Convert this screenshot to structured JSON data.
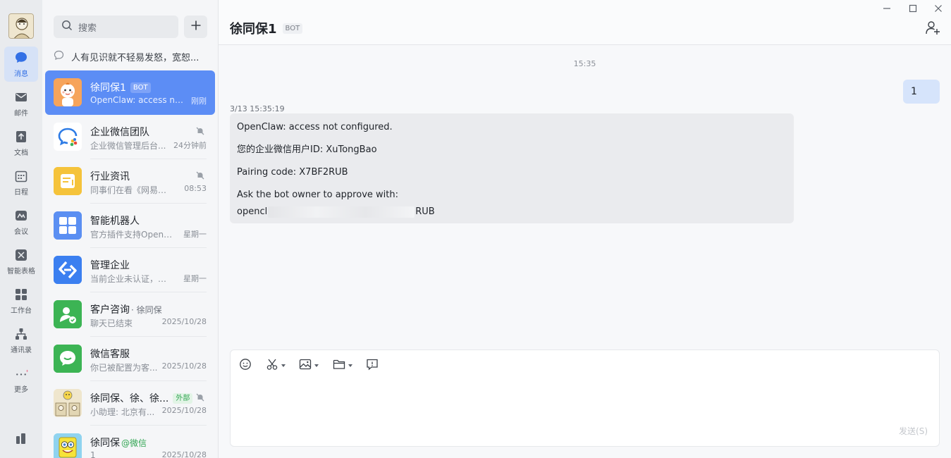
{
  "nav": {
    "items": [
      {
        "label": "消息",
        "icon": "chat-bubble-icon",
        "active": true
      },
      {
        "label": "邮件",
        "icon": "mail-icon"
      },
      {
        "label": "文档",
        "icon": "document-icon"
      },
      {
        "label": "日程",
        "icon": "calendar-icon"
      },
      {
        "label": "会议",
        "icon": "meeting-icon"
      },
      {
        "label": "智能表格",
        "icon": "smart-sheet-icon"
      },
      {
        "label": "工作台",
        "icon": "workbench-grid-icon"
      },
      {
        "label": "通讯录",
        "icon": "contacts-org-icon"
      },
      {
        "label": "更多",
        "icon": "more-dots-icon"
      }
    ]
  },
  "search": {
    "placeholder": "搜索"
  },
  "notice": {
    "text": "人有见识就不轻易发怒，宽恕..."
  },
  "conversations": [
    {
      "name": "徐同保1",
      "tag": "BOT",
      "preview": "OpenClaw: access no...",
      "time": "刚刚",
      "active": true
    },
    {
      "name": "企业微信团队",
      "preview": "企业微信管理后台...",
      "time": "24分钟前",
      "muted": true
    },
    {
      "name": "行业资讯",
      "preview": "同事们在看《网易的...",
      "time": "08:53",
      "muted": true
    },
    {
      "name": "智能机器人",
      "preview": "官方插件支持OpenC...",
      "time": "星期一"
    },
    {
      "name": "管理企业",
      "preview": "当前企业未认证，企...",
      "time": "星期一"
    },
    {
      "name": "客户咨询",
      "name_suffix": "· 徐同保",
      "preview": "聊天已结束",
      "time": "2025/10/28"
    },
    {
      "name": "微信客服",
      "preview": "你已被配置为客...",
      "time": "2025/10/28"
    },
    {
      "name": "徐同保、徐、徐...",
      "tag": "外部",
      "preview": "小助理: 北京有...",
      "time": "2025/10/28",
      "muted": true
    },
    {
      "name": "徐同保",
      "name_suffix": "@微信",
      "preview": "1",
      "time": "2025/10/28"
    }
  ],
  "chat": {
    "title": "徐同保1",
    "title_tag": "BOT",
    "center_time": "15:35",
    "my_message": "1",
    "bot_time": "3/13 15:35:19",
    "bot_lines": [
      "OpenClaw: access not configured.",
      "您的企业微信用户ID: XuTongBao",
      "Pairing code: X7BF2RUB",
      "Ask the bot owner to approve with:"
    ],
    "bot_cmd_start": "opencl",
    "bot_cmd_end": "RUB",
    "send_label": "发送(S)"
  },
  "colors": {
    "accent": "#5c8df5",
    "sidebar_bg": "#e9ebee",
    "bubble_me": "#d6e4fb",
    "bubble_bot": "#eaebee",
    "green": "#31a552"
  }
}
